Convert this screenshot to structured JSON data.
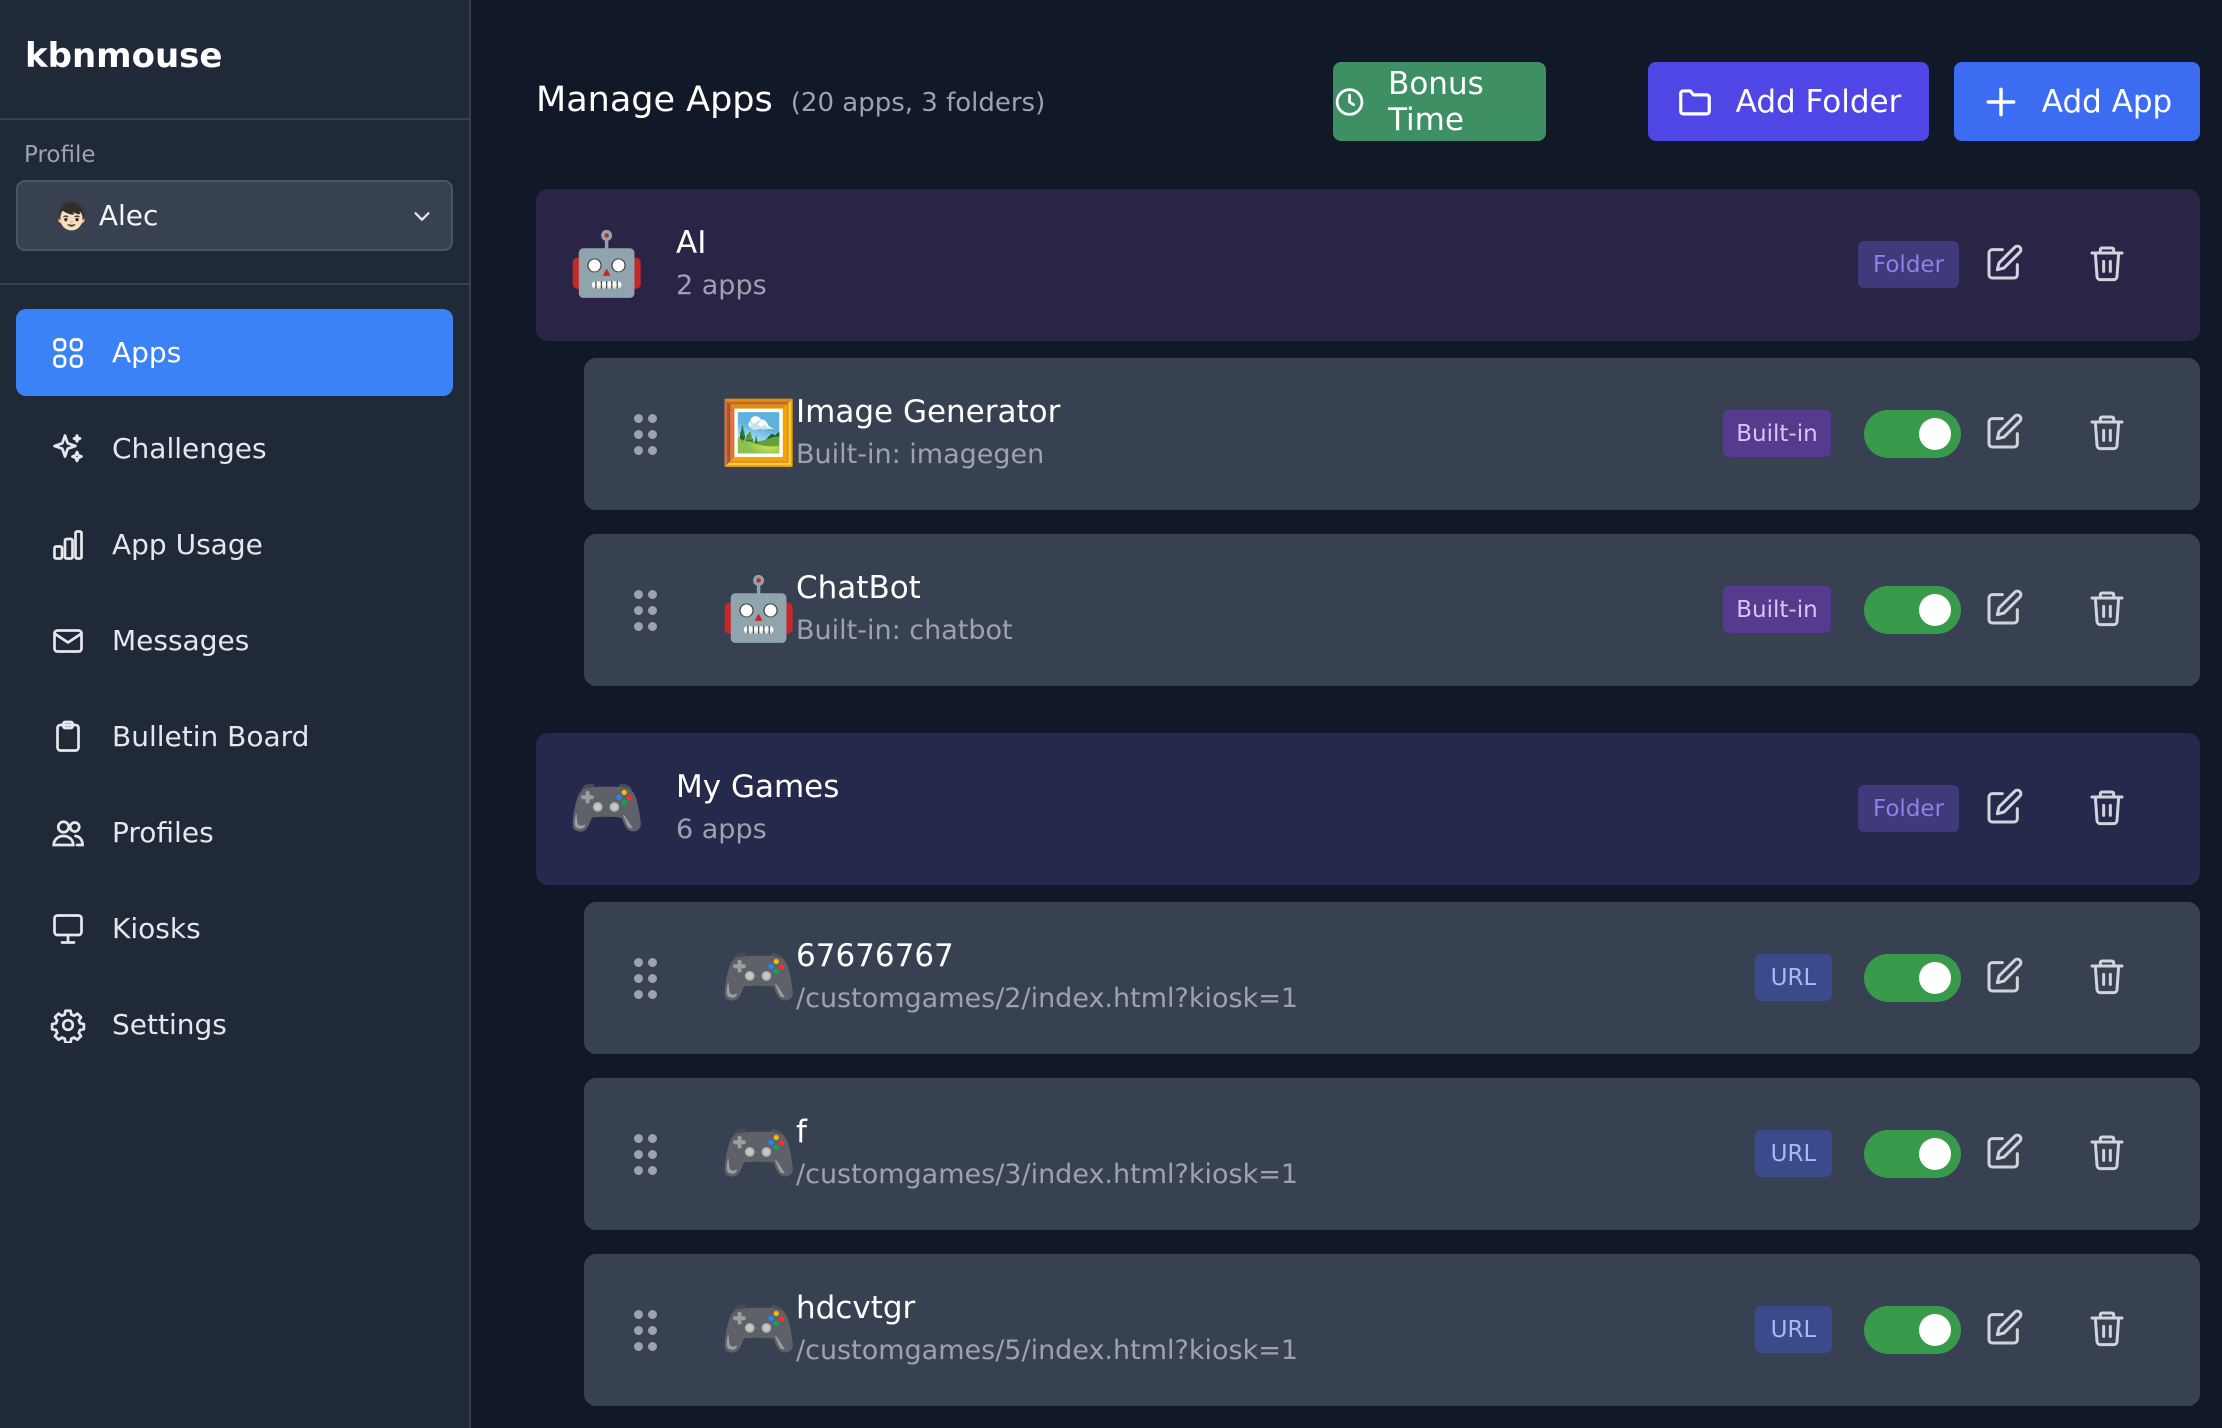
{
  "sidebar": {
    "brand": "kbnmouse",
    "profile_label": "Profile",
    "profile": {
      "emoji": "👦🏻",
      "name": "Alec"
    },
    "nav": [
      {
        "label": "Apps",
        "icon": "grid-icon",
        "active": true
      },
      {
        "label": "Challenges",
        "icon": "sparkles-icon"
      },
      {
        "label": "App Usage",
        "icon": "bar-chart-icon"
      },
      {
        "label": "Messages",
        "icon": "envelope-icon"
      },
      {
        "label": "Bulletin Board",
        "icon": "clipboard-icon"
      },
      {
        "label": "Profiles",
        "icon": "users-icon"
      },
      {
        "label": "Kiosks",
        "icon": "monitor-icon"
      },
      {
        "label": "Settings",
        "icon": "gear-icon"
      }
    ]
  },
  "header": {
    "title": "Manage Apps",
    "subtitle": "(20 apps, 3 folders)",
    "buttons": {
      "bonus": "Bonus Time",
      "add_folder": "Add Folder",
      "add_app": "Add App"
    }
  },
  "colors": {
    "active_nav": "#3b82f6",
    "bonus_button": "#3f8f64",
    "folder_button": "#4f46e5",
    "add_app_button": "#3b6cf1",
    "toggle_on": "#3a9a4c"
  },
  "folders": [
    {
      "icon": "🤖",
      "name": "AI",
      "count": "2 apps",
      "badge": "Folder",
      "apps": [
        {
          "icon": "🖼️",
          "name": "Image Generator",
          "source": "Built-in: imagegen",
          "badge": "Built-in",
          "enabled": true
        },
        {
          "icon": "🤖",
          "name": "ChatBot",
          "source": "Built-in: chatbot",
          "badge": "Built-in",
          "enabled": true
        }
      ]
    },
    {
      "icon": "🎮",
      "name": "My Games",
      "count": "6 apps",
      "badge": "Folder",
      "apps": [
        {
          "icon": "🎮",
          "name": "67676767",
          "source": "/customgames/2/index.html?kiosk=1",
          "badge": "URL",
          "enabled": true
        },
        {
          "icon": "🎮",
          "name": "f",
          "source": "/customgames/3/index.html?kiosk=1",
          "badge": "URL",
          "enabled": true
        },
        {
          "icon": "🎮",
          "name": "hdcvtgr",
          "source": "/customgames/5/index.html?kiosk=1",
          "badge": "URL",
          "enabled": true
        }
      ]
    }
  ]
}
